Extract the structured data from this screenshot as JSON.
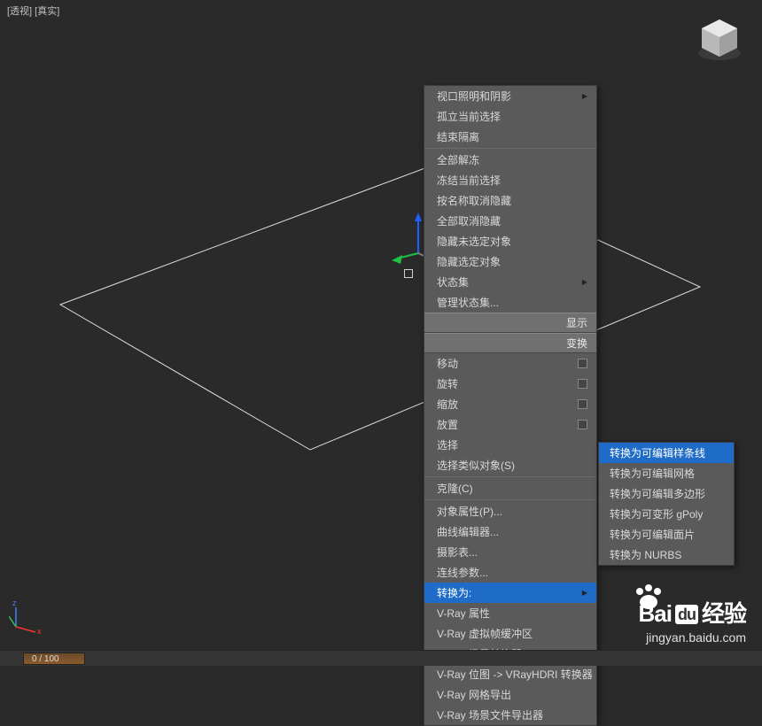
{
  "viewport": {
    "label": "[透视] [真实]"
  },
  "timeline": {
    "position": "0 / 100"
  },
  "menu": {
    "items": [
      {
        "label": "视口照明和阴影",
        "type": "arrow"
      },
      {
        "label": "孤立当前选择",
        "type": "plain"
      },
      {
        "label": "结束隔离",
        "type": "plain"
      },
      {
        "sep": true
      },
      {
        "label": "全部解冻",
        "type": "plain"
      },
      {
        "label": "冻结当前选择",
        "type": "plain"
      },
      {
        "label": "按名称取消隐藏",
        "type": "plain"
      },
      {
        "label": "全部取消隐藏",
        "type": "plain"
      },
      {
        "label": "隐藏未选定对象",
        "type": "plain"
      },
      {
        "label": "隐藏选定对象",
        "type": "plain"
      },
      {
        "label": "状态集",
        "type": "arrow"
      },
      {
        "label": "管理状态集...",
        "type": "plain"
      },
      {
        "header": "显示"
      },
      {
        "header": "变换"
      },
      {
        "label": "移动",
        "type": "check"
      },
      {
        "label": "旋转",
        "type": "check"
      },
      {
        "label": "缩放",
        "type": "check"
      },
      {
        "label": "放置",
        "type": "check"
      },
      {
        "label": "选择",
        "type": "plain"
      },
      {
        "label": "选择类似对象(S)",
        "type": "plain"
      },
      {
        "sep": true
      },
      {
        "label": "克隆(C)",
        "type": "plain"
      },
      {
        "sep": true
      },
      {
        "label": "对象属性(P)...",
        "type": "plain"
      },
      {
        "label": "曲线编辑器...",
        "type": "plain"
      },
      {
        "label": "摄影表...",
        "type": "plain"
      },
      {
        "label": "连线参数...",
        "type": "plain"
      },
      {
        "label": "转换为:",
        "type": "arrow",
        "highlight": true
      },
      {
        "label": "V-Ray 属性",
        "type": "plain"
      },
      {
        "label": "V-Ray 虚拟帧缓冲区",
        "type": "plain"
      },
      {
        "label": "V-Ray 场景转换器",
        "type": "plain"
      },
      {
        "label": "V-Ray 位图 -> VRayHDRI 转换器",
        "type": "plain"
      },
      {
        "label": "V-Ray 网格导出",
        "type": "plain"
      },
      {
        "label": "V-Ray 场景文件导出器",
        "type": "plain"
      }
    ]
  },
  "submenu": {
    "items": [
      {
        "label": "转换为可编辑样条线",
        "highlight": true
      },
      {
        "label": "转换为可编辑网格"
      },
      {
        "label": "转换为可编辑多边形"
      },
      {
        "label": "转换为可变形 gPoly"
      },
      {
        "label": "转换为可编辑面片"
      },
      {
        "label": "转换为 NURBS"
      }
    ]
  },
  "watermark": {
    "brand1": "Bai",
    "brand2": "du",
    "brand3": "经验",
    "url": "jingyan.baidu.com"
  }
}
